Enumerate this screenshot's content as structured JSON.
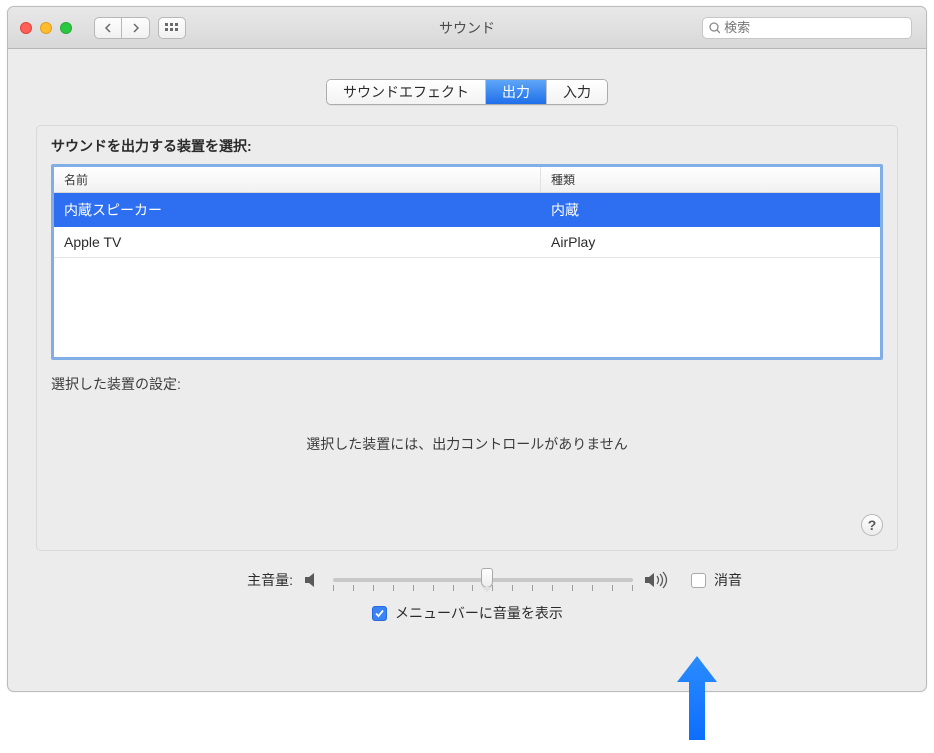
{
  "window": {
    "title": "サウンド",
    "search_placeholder": "検索"
  },
  "tabs": {
    "items": [
      {
        "label": "サウンドエフェクト",
        "selected": false
      },
      {
        "label": "出力",
        "selected": true
      },
      {
        "label": "入力",
        "selected": false
      }
    ]
  },
  "panel": {
    "title": "サウンドを出力する装置を選択:",
    "columns": {
      "name": "名前",
      "type": "種類"
    },
    "rows": [
      {
        "name": "内蔵スピーカー",
        "type": "内蔵",
        "selected": true
      },
      {
        "name": "Apple TV",
        "type": "AirPlay",
        "selected": false
      }
    ],
    "settings_label": "選択した装置の設定:",
    "no_controls": "選択した装置には、出力コントロールがありません"
  },
  "footer": {
    "volume_label": "主音量:",
    "mute_label": "消音",
    "mute_checked": false,
    "menubar_label": "メニューバーに音量を表示",
    "menubar_checked": true,
    "volume_value": 50
  },
  "help": "?"
}
